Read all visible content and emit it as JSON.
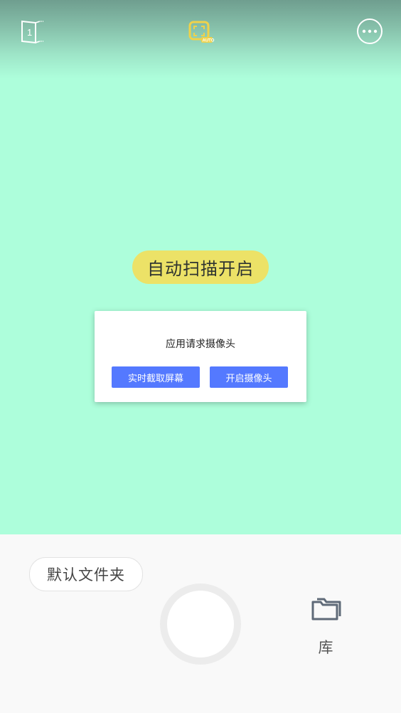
{
  "top_bar": {
    "page_count": "1",
    "auto_icon_text": "AUTO"
  },
  "camera": {
    "auto_scan_label": "自动扫描开启"
  },
  "dialog": {
    "title": "应用请求摄像头",
    "capture_screen_label": "实时截取屏幕",
    "open_camera_label": "开启摄像头"
  },
  "bottom_bar": {
    "folder_label": "默认文件夹",
    "library_label": "库"
  },
  "colors": {
    "camera_bg": "#adfedb",
    "pill_bg": "#ece267",
    "button_blue": "#5479ff",
    "auto_icon": "#efd24a"
  }
}
